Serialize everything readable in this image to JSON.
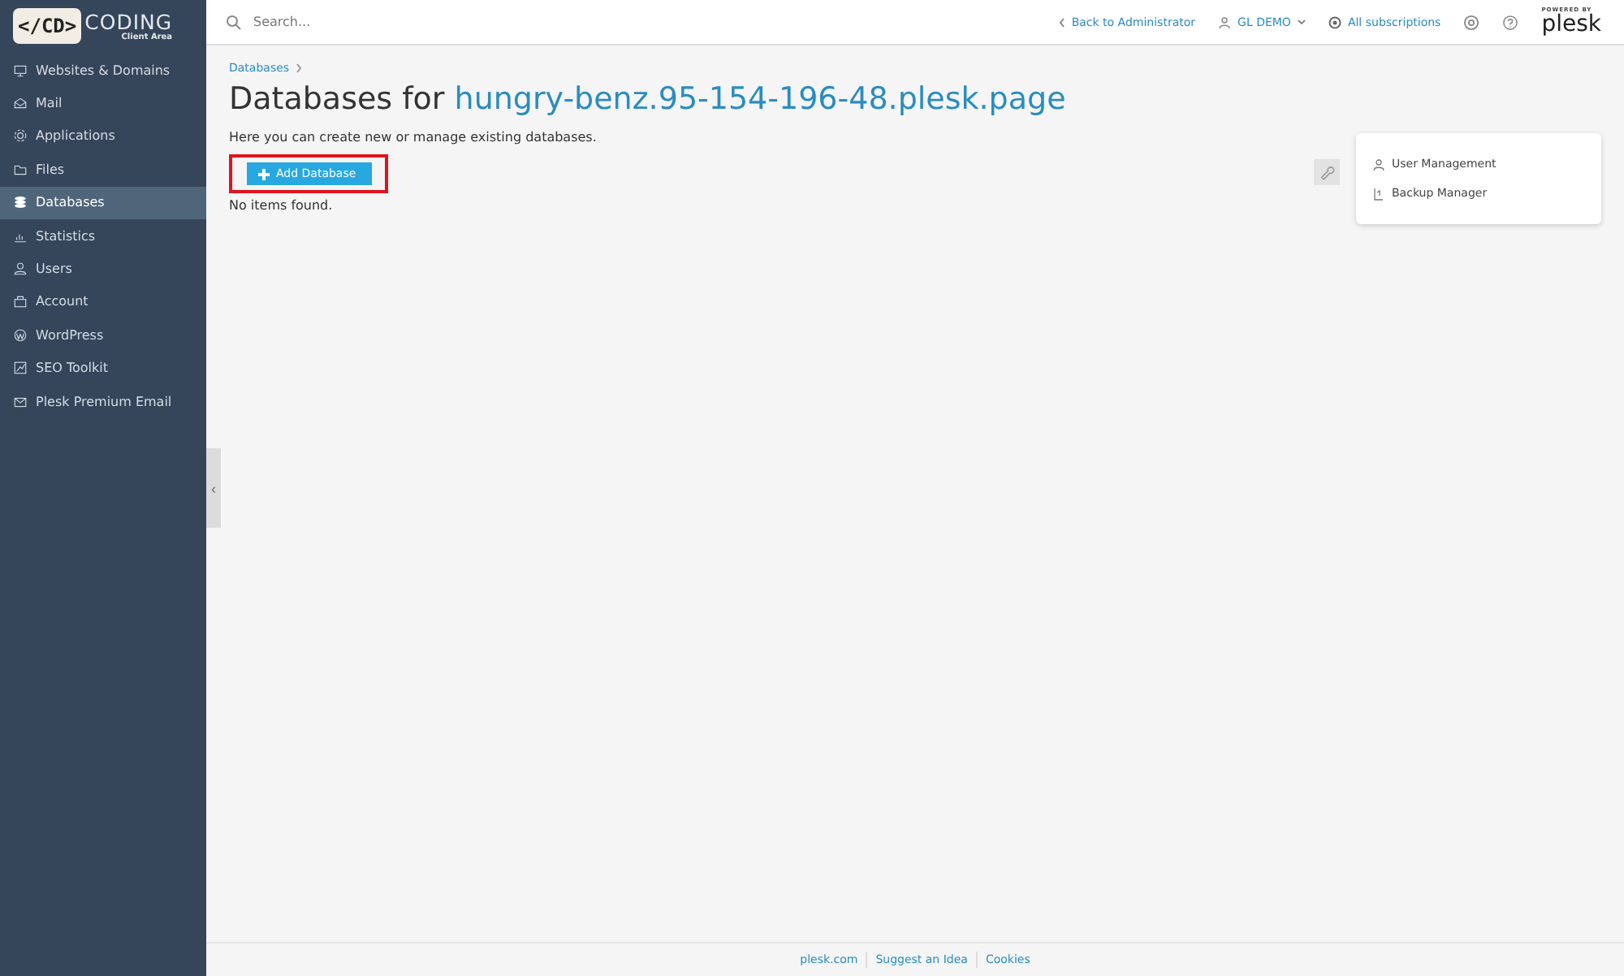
{
  "logo": {
    "mark": "</CD>",
    "name": "CODING",
    "subtitle": "Client Area"
  },
  "sidebar": {
    "items": [
      {
        "label": "Websites & Domains",
        "selected": false
      },
      {
        "label": "Mail",
        "selected": false
      },
      {
        "label": "Applications",
        "selected": false
      },
      {
        "label": "Files",
        "selected": false
      },
      {
        "label": "Databases",
        "selected": true
      },
      {
        "label": "Statistics",
        "selected": false
      },
      {
        "label": "Users",
        "selected": false
      },
      {
        "label": "Account",
        "selected": false
      },
      {
        "label": "WordPress",
        "selected": false
      },
      {
        "label": "SEO Toolkit",
        "selected": false
      },
      {
        "label": "Plesk Premium Email",
        "selected": false
      }
    ],
    "collapse": "‹"
  },
  "header": {
    "search": {
      "placeholder": "Search..."
    },
    "back": "Back to Administrator",
    "user": "GL DEMO",
    "subscriptions": "All subscriptions",
    "powered_by": "POWERED BY",
    "brand": "plesk"
  },
  "breadcrumbs": [
    "Databases"
  ],
  "title": {
    "prefix": "Databases for",
    "domain": "hungry-benz.95-154-196-48.plesk.page"
  },
  "description": "Here you can create new or manage existing databases.",
  "add_button": "Add Database",
  "empty": "No items found.",
  "side_panel": [
    "User Management",
    "Backup Manager"
  ],
  "footer": [
    "plesk.com",
    "Suggest an Idea",
    "Cookies"
  ]
}
